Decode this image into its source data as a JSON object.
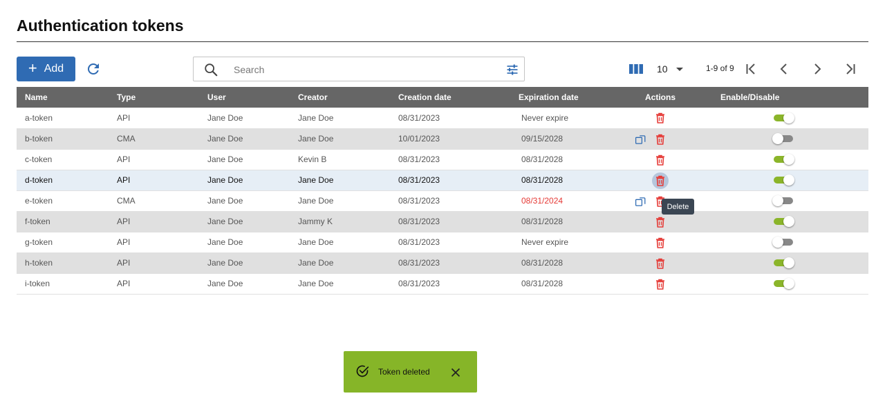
{
  "page": {
    "title": "Authentication tokens"
  },
  "toolbar": {
    "add_label": "Add",
    "search_placeholder": "Search",
    "page_size": "10",
    "page_range": "1-9 of 9"
  },
  "table": {
    "headers": [
      "Name",
      "Type",
      "User",
      "Creator",
      "Creation date",
      "Expiration date",
      "Actions",
      "Enable/Disable"
    ],
    "rows": [
      {
        "name": "a-token",
        "type": "API",
        "user": "Jane Doe",
        "creator": "Jane Doe",
        "created": "08/31/2023",
        "expires": "Never expire",
        "expired": false,
        "copy": false,
        "enabled": true
      },
      {
        "name": "b-token",
        "type": "CMA",
        "user": "Jane Doe",
        "creator": "Jane Doe",
        "created": "10/01/2023",
        "expires": "09/15/2028",
        "expired": false,
        "copy": true,
        "enabled": false
      },
      {
        "name": "c-token",
        "type": "API",
        "user": "Jane Doe",
        "creator": "Kevin B",
        "created": "08/31/2023",
        "expires": "08/31/2028",
        "expired": false,
        "copy": false,
        "enabled": true
      },
      {
        "name": "d-token",
        "type": "API",
        "user": "Jane Doe",
        "creator": "Jane Doe",
        "created": "08/31/2023",
        "expires": "08/31/2028",
        "expired": false,
        "copy": false,
        "enabled": true,
        "selected": true
      },
      {
        "name": "e-token",
        "type": "CMA",
        "user": "Jane Doe",
        "creator": "Jane Doe",
        "created": "08/31/2023",
        "expires": "08/31/2024",
        "expired": true,
        "copy": true,
        "enabled": false
      },
      {
        "name": "f-token",
        "type": "API",
        "user": "Jane Doe",
        "creator": "Jammy K",
        "created": "08/31/2023",
        "expires": "08/31/2028",
        "expired": false,
        "copy": false,
        "enabled": true
      },
      {
        "name": "g-token",
        "type": "API",
        "user": "Jane Doe",
        "creator": "Jane Doe",
        "created": "08/31/2023",
        "expires": "Never expire",
        "expired": false,
        "copy": false,
        "enabled": false
      },
      {
        "name": "h-token",
        "type": "API",
        "user": "Jane Doe",
        "creator": "Jane Doe",
        "created": "08/31/2023",
        "expires": "08/31/2028",
        "expired": false,
        "copy": false,
        "enabled": true
      },
      {
        "name": "i-token",
        "type": "API",
        "user": "Jane Doe",
        "creator": "Jane Doe",
        "created": "08/31/2023",
        "expires": "08/31/2028",
        "expired": false,
        "copy": false,
        "enabled": true
      }
    ]
  },
  "tooltip": {
    "text": "Delete"
  },
  "snackbar": {
    "message": "Token deleted"
  },
  "icons": {
    "add": "plus-icon",
    "refresh": "refresh-icon",
    "search": "search-icon",
    "filter": "tune-icon",
    "columns": "columns-icon",
    "first": "first-page-icon",
    "prev": "chevron-left-icon",
    "next": "chevron-right-icon",
    "last": "last-page-icon",
    "copy": "copy-icon",
    "delete": "trash-icon",
    "success": "check-circle-icon",
    "close": "close-icon"
  },
  "colors": {
    "primary": "#2f6bb3",
    "header": "#666666",
    "danger": "#e53935",
    "toggle_on": "#8bb52a",
    "snackbar": "#86b528",
    "tooltip": "#3b4653"
  }
}
